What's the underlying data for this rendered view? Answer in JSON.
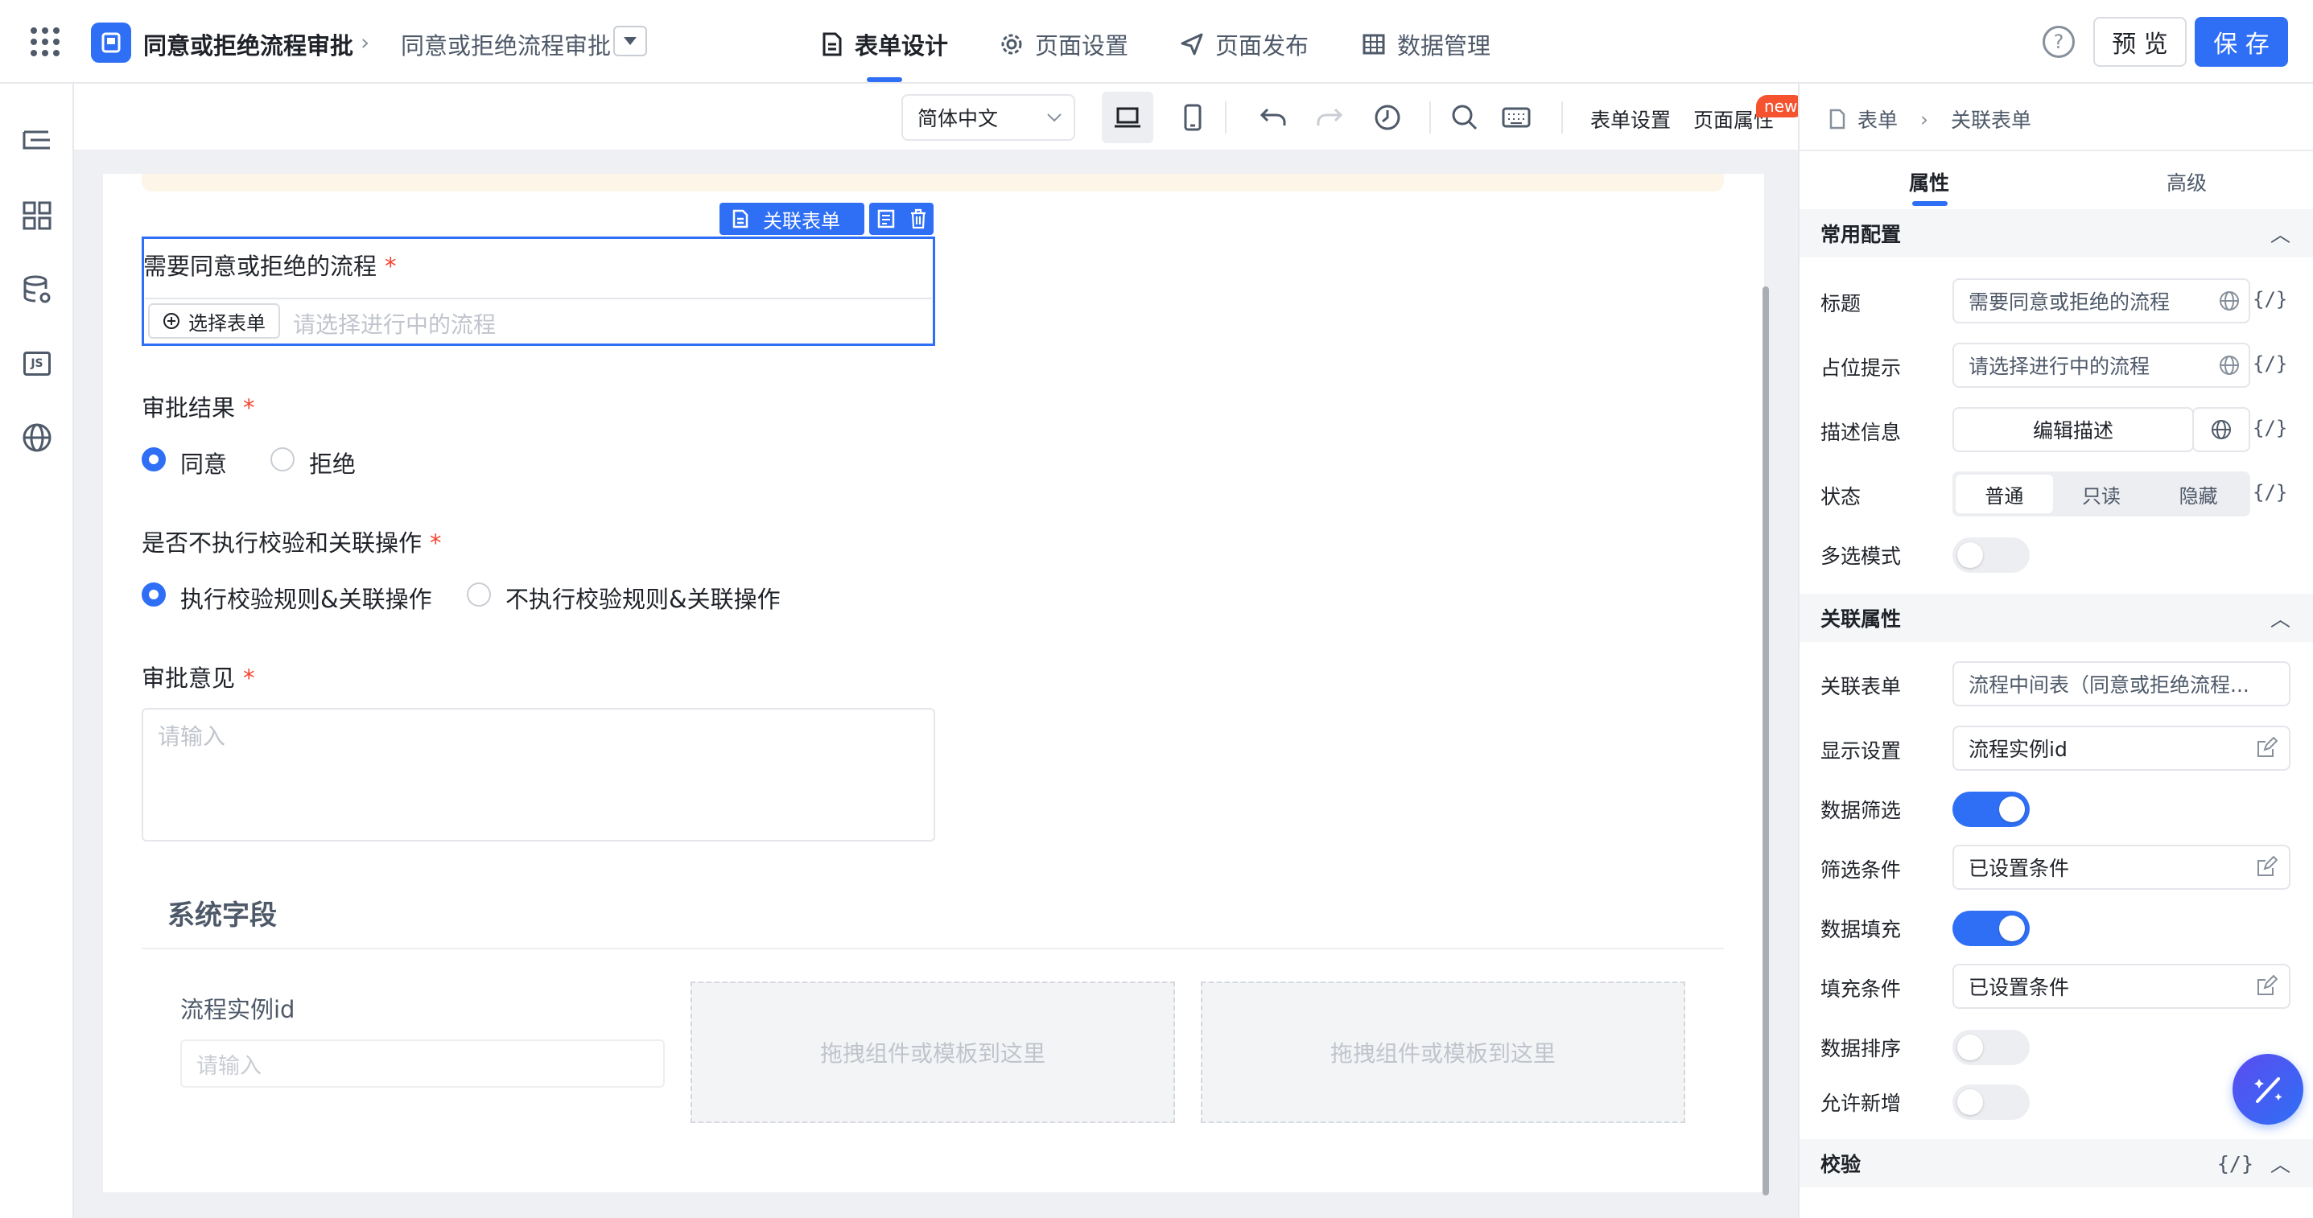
{
  "header": {
    "app_title": "同意或拒绝流程审批",
    "breadcrumb_current": "同意或拒绝流程审批",
    "nav": [
      {
        "label": "表单设计",
        "icon": "document-icon",
        "active": true
      },
      {
        "label": "页面设置",
        "icon": "gear-icon"
      },
      {
        "label": "页面发布",
        "icon": "send-icon"
      },
      {
        "label": "数据管理",
        "icon": "table-icon"
      }
    ],
    "preview_label": "预 览",
    "save_label": "保 存"
  },
  "toolbar": {
    "language": "简体中文",
    "form_settings": "表单设置",
    "page_attributes": "页面属性",
    "new_badge": "new"
  },
  "canvas": {
    "selected_badge": "关联表单",
    "field1": {
      "label": "需要同意或拒绝的流程",
      "button": "选择表单",
      "placeholder": "请选择进行中的流程"
    },
    "field2": {
      "label": "审批结果",
      "options": [
        "同意",
        "拒绝"
      ],
      "selected": 0
    },
    "field3": {
      "label": "是否不执行校验和关联操作",
      "options": [
        "执行校验规则&关联操作",
        "不执行校验规则&关联操作"
      ],
      "selected": 0
    },
    "field4": {
      "label": "审批意见",
      "placeholder": "请输入"
    },
    "system_section": "系统字段",
    "sys_field": {
      "label": "流程实例id",
      "placeholder": "请输入"
    },
    "dropzone_text": "拖拽组件或模板到这里"
  },
  "panel": {
    "breadcrumb": [
      "表单",
      "关联表单"
    ],
    "tabs": [
      "属性",
      "高级"
    ],
    "active_tab": 0,
    "section_common": "常用配置",
    "title_label": "标题",
    "title_value": "需要同意或拒绝的流程",
    "placeholder_label": "占位提示",
    "placeholder_value": "请选择进行中的流程",
    "desc_label": "描述信息",
    "desc_button": "编辑描述",
    "state_label": "状态",
    "state_options": [
      "普通",
      "只读",
      "隐藏"
    ],
    "state_selected": 0,
    "multi_label": "多选模式",
    "multi_on": false,
    "section_assoc": "关联属性",
    "assoc_form_label": "关联表单",
    "assoc_form_value": "流程中间表（同意或拒绝流程...",
    "display_label": "显示设置",
    "display_value": "流程实例id",
    "filter_label": "数据筛选",
    "filter_on": true,
    "filter_cond_label": "筛选条件",
    "filter_cond_value": "已设置条件",
    "fill_label": "数据填充",
    "fill_on": true,
    "fill_cond_label": "填充条件",
    "fill_cond_value": "已设置条件",
    "sort_label": "数据排序",
    "sort_on": false,
    "allow_add_label": "允许新增",
    "allow_add_on": false,
    "section_validate": "校验",
    "code_symbol": "{/}"
  }
}
